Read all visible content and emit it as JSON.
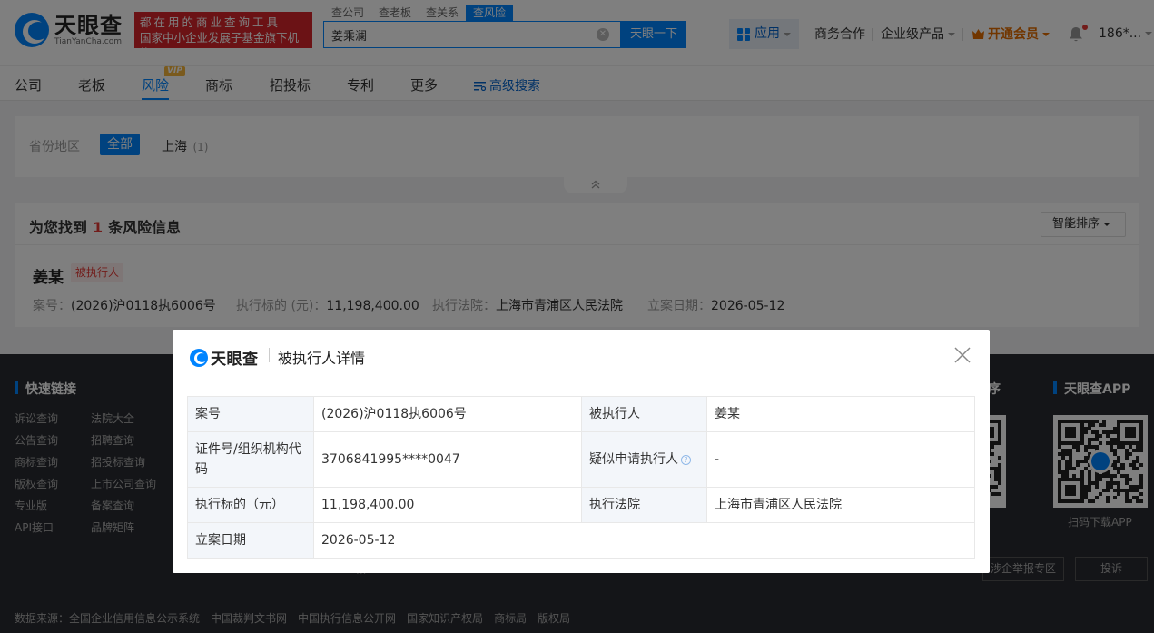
{
  "header": {
    "logo_cn": "天眼查",
    "logo_en": "TianYanCha.com",
    "slogan_line1": "都在用的商业查询工具",
    "slogan_line2": "国家中小企业发展子基金旗下机构",
    "search_tabs": [
      "查公司",
      "查老板",
      "查关系",
      "查风险"
    ],
    "search_value": "姜乘澜",
    "search_button": "天眼一下",
    "apps": "应用",
    "business": "商务合作",
    "enterprise": "企业级产品",
    "vip": "开通会员",
    "user": "186*..."
  },
  "nav": {
    "items": [
      "公司",
      "老板",
      "风险",
      "商标",
      "招投标",
      "专利",
      "更多"
    ],
    "active": "风险",
    "vip_badge": "VIP",
    "advanced": "高级搜索"
  },
  "filter": {
    "label": "省份地区",
    "all": "全部",
    "option": "上海",
    "option_count": "(1)"
  },
  "result": {
    "prefix": "为您找到",
    "count": "1",
    "suffix": "条风险信息",
    "sort": "智能排序",
    "name": "姜某",
    "tag": "被执行人",
    "case_key": "案号：",
    "case_val": "(2026)沪0118执6006号",
    "amount_key": "执行标的 (元)：",
    "amount_val": "11,198,400.00",
    "court_key": "执行法院：",
    "court_val": "上海市青浦区人民法院",
    "date_key": "立案日期：",
    "date_val": "2026-05-12"
  },
  "footer": {
    "quick_links_title": "快速链接",
    "col1": [
      "诉讼查询",
      "公告查询",
      "商标查询",
      "版权查询",
      "专业版",
      "API接口"
    ],
    "col2": [
      "法院大全",
      "招聘查询",
      "招投标查询",
      "上市公司查询",
      "备案查询",
      "品牌矩阵"
    ],
    "app_title_partial": "序",
    "app_title": "天眼查APP",
    "app_caption": "扫码下载APP",
    "report_btn": "涉企举报专区",
    "complaint_btn": "投诉",
    "hidden_link_fragment": "...",
    "bottom_label": "数据来源：",
    "sources": [
      "全国企业信用信息公示系统",
      "中国裁判文书网",
      "中国执行信息公开网",
      "国家知识产权局",
      "商标局",
      "版权局"
    ]
  },
  "modal": {
    "logo": "天眼查",
    "title": "被执行人详情",
    "rows": {
      "case_no_label": "案号",
      "case_no": "(2026)沪0118执6006号",
      "person_label": "被执行人",
      "person": "姜某",
      "id_label": "证件号/组织机构代码",
      "id": "3706841995****0047",
      "applicant_label": "疑似申请执行人",
      "applicant": "-",
      "amount_label": "执行标的（元）",
      "amount": "11,198,400.00",
      "court_label": "执行法院",
      "court": "上海市青浦区人民法院",
      "date_label": "立案日期",
      "date": "2026-05-12"
    }
  },
  "colors": {
    "brand": "#0084ff",
    "danger": "#e53935",
    "slogan_bg": "#d7242a",
    "vip": "#e26d00",
    "footer_bg": "#292b31"
  }
}
